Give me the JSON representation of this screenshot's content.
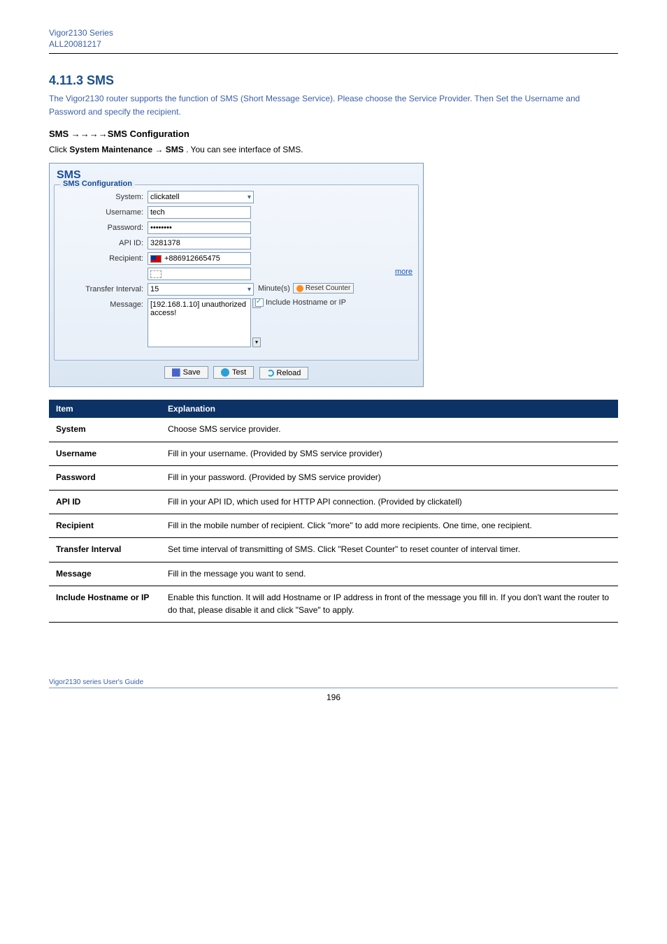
{
  "header": {
    "product": "Vigor2130 Series",
    "subtitle": "ALL20081217"
  },
  "section": {
    "title": "4.11.3 SMS",
    "desc": "The Vigor2130 router supports the function of SMS (Short Message Service). Please choose the Service Provider. Then Set the Username and Password and specify the recipient."
  },
  "sub": {
    "title": "SMS →→→→SMS Configuration",
    "pathPrefix": "Click ",
    "pathBoldA": "System Maintenance ",
    "arrow": "→",
    "pathBoldB": "SMS",
    "pathSuffix": ". You can see interface of SMS."
  },
  "screenshot": {
    "title": "SMS",
    "legend": "SMS Configuration",
    "labels": {
      "system": "System:",
      "username": "Username:",
      "password": "Password:",
      "apiId": "API ID:",
      "recipient": "Recipient:",
      "interval": "Transfer Interval:",
      "message": "Message:"
    },
    "values": {
      "system": "clickatell",
      "username": "tech",
      "password": "••••••••",
      "apiId": "3281378",
      "recipient1": "+886912665475",
      "interval": "15",
      "message": "[192.168.1.10] unauthorized access!"
    },
    "more": "more",
    "minutes": "Minute(s)",
    "resetCounter": "Reset Counter",
    "includeHost": "Include Hostname or IP",
    "buttons": {
      "save": "Save",
      "test": "Test",
      "reload": "Reload"
    }
  },
  "table": {
    "h1": "Item",
    "h2": "Explanation",
    "rows": [
      {
        "t": "System",
        "d": "Choose SMS service provider."
      },
      {
        "t": "Username",
        "d": "Fill in your username. (Provided by SMS service provider)"
      },
      {
        "t": "Password",
        "d": "Fill in your password. (Provided by SMS service provider)"
      },
      {
        "t": "API ID",
        "d": "Fill in your API ID, which used for HTTP API connection. (Provided by clickatell)"
      },
      {
        "t": "Recipient",
        "d": "Fill in the mobile number of recipient. Click \"more\" to add more recipients. One time, one recipient."
      },
      {
        "t": "Transfer Interval",
        "d": "Set time interval of transmitting of SMS. Click \"Reset Counter\" to reset counter of interval timer."
      },
      {
        "t": "Message",
        "d": "Fill in the message you want to send."
      },
      {
        "t": "Include Hostname or IP",
        "d": "Enable this function. It will add Hostname or IP address in front of the message you fill in. If you don't want the router to do that, please disable it and click \"Save\" to apply."
      }
    ]
  },
  "footer": {
    "note": "Vigor2130 series User's Guide",
    "page": "196"
  }
}
